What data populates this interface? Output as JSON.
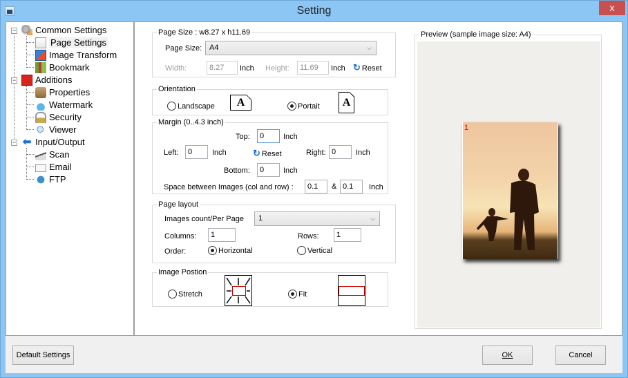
{
  "window": {
    "title": "Setting",
    "close_label": "x"
  },
  "sidebar": {
    "groups": [
      {
        "label": "Common Settings",
        "icon": "settings-gear-icon",
        "expander": "−",
        "items": [
          {
            "label": "Page Settings",
            "icon": "page-settings-icon",
            "selected": true
          },
          {
            "label": "Image Transform",
            "icon": "image-transform-icon",
            "selected": false
          },
          {
            "label": "Bookmark",
            "icon": "bookmark-book-icon",
            "selected": false
          }
        ]
      },
      {
        "label": "Additions",
        "icon": "pdf-document-icon",
        "expander": "−",
        "items": [
          {
            "label": "Properties",
            "icon": "properties-icon"
          },
          {
            "label": "Watermark",
            "icon": "watermark-drop-icon"
          },
          {
            "label": "Security",
            "icon": "padlock-icon"
          },
          {
            "label": "Viewer",
            "icon": "magnifier-icon"
          }
        ]
      },
      {
        "label": "Input/Output",
        "icon": "arrow-left-icon",
        "expander": "−",
        "items": [
          {
            "label": "Scan",
            "icon": "scanner-icon"
          },
          {
            "label": "Email",
            "icon": "envelope-icon"
          },
          {
            "label": "FTP",
            "icon": "globe-icon"
          }
        ]
      }
    ]
  },
  "page_size": {
    "legend": "Page Size : w8.27 x h11.69",
    "label": "Page Size:",
    "value": "A4",
    "width_label": "Width:",
    "width_value": "8.27",
    "height_label": "Height:",
    "height_value": "11.69",
    "unit": "Inch",
    "reset_label": "Reset"
  },
  "orientation": {
    "legend": "Orientation",
    "landscape_label": "Landscape",
    "portrait_label": "Portait",
    "selected": "portrait",
    "icon_glyph": "A"
  },
  "margin": {
    "legend": "Margin (0..4.3 inch)",
    "top_label": "Top:",
    "top_value": "0",
    "left_label": "Left:",
    "left_value": "0",
    "right_label": "Right:",
    "right_value": "0",
    "bottom_label": "Bottom:",
    "bottom_value": "0",
    "unit": "Inch",
    "reset_label": "Reset",
    "spacing_label": "Space between Images (col and row) :",
    "spacing_col": "0.1",
    "spacing_sep": "&",
    "spacing_row": "0.1"
  },
  "page_layout": {
    "legend": "Page layout",
    "count_label": "Images count/Per Page",
    "count_value": "1",
    "columns_label": "Columns:",
    "columns_value": "1",
    "rows_label": "Rows:",
    "rows_value": "1",
    "order_label": "Order:",
    "horizontal_label": "Horizontal",
    "vertical_label": "Vertical",
    "order_selected": "horizontal"
  },
  "image_position": {
    "legend": "Image Postion",
    "stretch_label": "Stretch",
    "fit_label": "Fit",
    "selected": "fit"
  },
  "preview": {
    "legend": "Preview (sample image size: A4)",
    "page_number": "1"
  },
  "footer": {
    "default_label": "Default Settings",
    "ok_label": "OK",
    "cancel_label": "Cancel"
  },
  "colors": {
    "titlebar": "#8cc6f4",
    "close": "#c75050",
    "page_number": "#e00000",
    "position_frame": "#d00000"
  }
}
